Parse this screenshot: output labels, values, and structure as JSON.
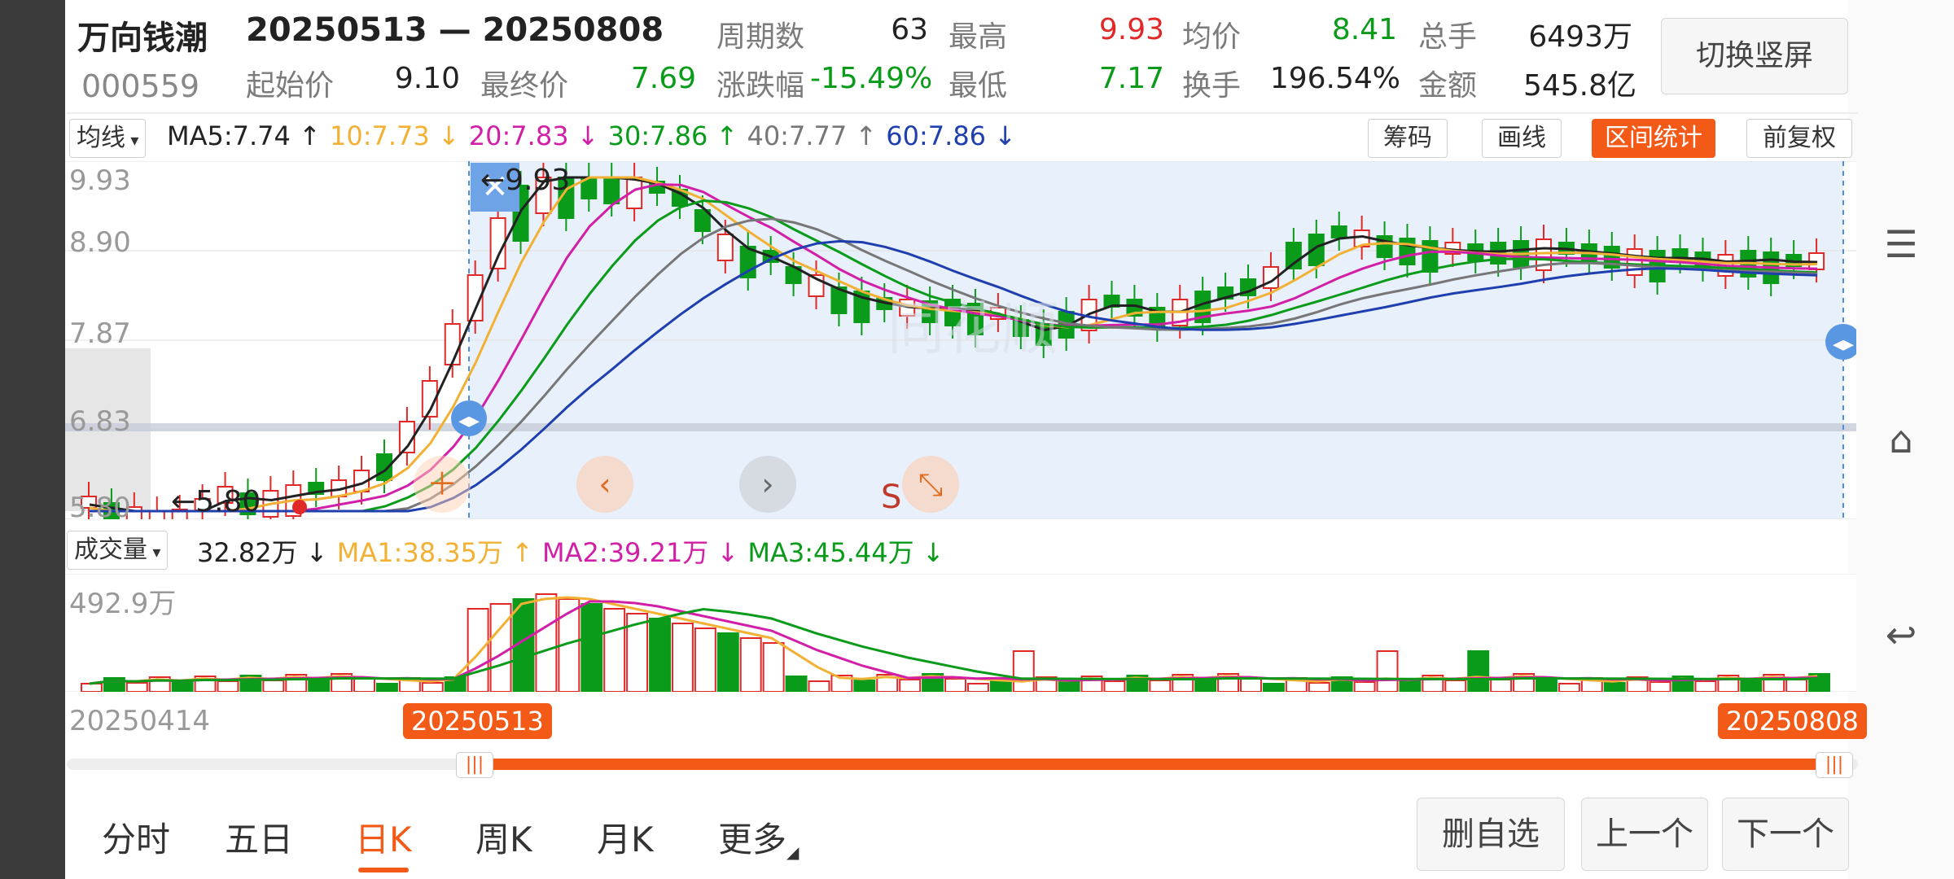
{
  "header": {
    "stock_name": "万向钱潮",
    "date_range": "20250513 — 20250808",
    "stock_code": "000559",
    "stats_row1": [
      {
        "label": "周期数",
        "value": "63",
        "color": "dark"
      },
      {
        "label": "最高",
        "value": "9.93",
        "color": "red"
      },
      {
        "label": "均价",
        "value": "8.41",
        "color": "green"
      },
      {
        "label": "总手",
        "value": "6493万",
        "color": "dark"
      }
    ],
    "stats_row2": [
      {
        "label": "起始价",
        "value": "9.10",
        "color": "dark"
      },
      {
        "label": "最终价",
        "value": "7.69",
        "color": "green"
      },
      {
        "label": "涨跌幅",
        "value": "-15.49%",
        "color": "green"
      },
      {
        "label": "最低",
        "value": "7.17",
        "color": "green"
      },
      {
        "label": "换手",
        "value": "196.54%",
        "color": "dark"
      },
      {
        "label": "金额",
        "value": "545.8亿",
        "color": "dark"
      }
    ],
    "switch_button": "切换竖屏"
  },
  "ma_bar": {
    "selector": "均线",
    "items": [
      {
        "text": "MA5:7.74 ↑",
        "color": "#222222"
      },
      {
        "text": "10:7.73 ↓",
        "color": "#f2b134"
      },
      {
        "text": "20:7.83 ↓",
        "color": "#d21fa8"
      },
      {
        "text": "30:7.86 ↑",
        "color": "#0a9b1b"
      },
      {
        "text": "40:7.77 ↑",
        "color": "#777777"
      },
      {
        "text": "60:7.86 ↓",
        "color": "#1f3fae"
      }
    ],
    "buttons": [
      "筹码",
      "画线",
      "区间统计",
      "前复权"
    ]
  },
  "price_chart": {
    "y_labels": [
      "9.93",
      "8.90",
      "7.87",
      "6.83",
      "5.80"
    ],
    "high_label": "9.93",
    "low_label": "5.80",
    "watermark": "同花顺"
  },
  "volume_bar": {
    "selector": "成交量",
    "items": [
      {
        "text": "32.82万 ↓",
        "color": "#222222"
      },
      {
        "text": "MA1:38.35万 ↑",
        "color": "#f2b134"
      },
      {
        "text": "MA2:39.21万 ↓",
        "color": "#d21fa8"
      },
      {
        "text": "MA3:45.44万 ↓",
        "color": "#0a9b1b"
      }
    ],
    "y_label": "492.9万"
  },
  "timeline": {
    "start_date": "20250414",
    "range_start": "20250513",
    "range_end": "20250808"
  },
  "tabs": [
    "分时",
    "五日",
    "日K",
    "周K",
    "月K",
    "更多"
  ],
  "active_tab": "日K",
  "bottom_buttons": [
    "删自选",
    "上一个",
    "下一个"
  ],
  "colors": {
    "accent": "#f35a17",
    "up": "#e02828",
    "down": "#0a9b1b",
    "selection": "#e8f0fb"
  }
}
